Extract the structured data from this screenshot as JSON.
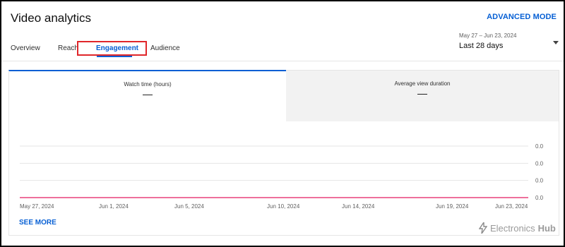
{
  "header": {
    "title": "Video analytics",
    "advanced_mode_label": "ADVANCED MODE"
  },
  "tabs": [
    {
      "label": "Overview",
      "active": false
    },
    {
      "label": "Reach",
      "active": false
    },
    {
      "label": "Engagement",
      "active": true
    },
    {
      "label": "Audience",
      "active": false
    }
  ],
  "date_filter": {
    "range": "May 27 – Jun 23, 2024",
    "label": "Last 28 days"
  },
  "metrics": [
    {
      "label": "Watch time (hours)",
      "value": "—",
      "selected": true
    },
    {
      "label": "Average view duration",
      "value": "—",
      "selected": false
    }
  ],
  "chart_data": {
    "type": "line",
    "x": [
      "May 27, 2024",
      "Jun 1, 2024",
      "Jun 5, 2024",
      "Jun 10, 2024",
      "Jun 14, 2024",
      "Jun 19, 2024",
      "Jun 23, 2024"
    ],
    "series": [
      {
        "values": [
          0.0,
          0.0,
          0.0,
          0.0,
          0.0,
          0.0,
          0.0
        ]
      }
    ],
    "y_ticks": [
      "0.0",
      "0.0",
      "0.0",
      "0.0"
    ],
    "grid": true
  },
  "footer": {
    "see_more_label": "SEE MORE"
  },
  "watermark": {
    "brand": "Electronics",
    "brand_suffix": "Hub"
  },
  "colors": {
    "accent": "#065fd4",
    "series_line": "#e9407a",
    "highlight_box": "#e0262a"
  }
}
